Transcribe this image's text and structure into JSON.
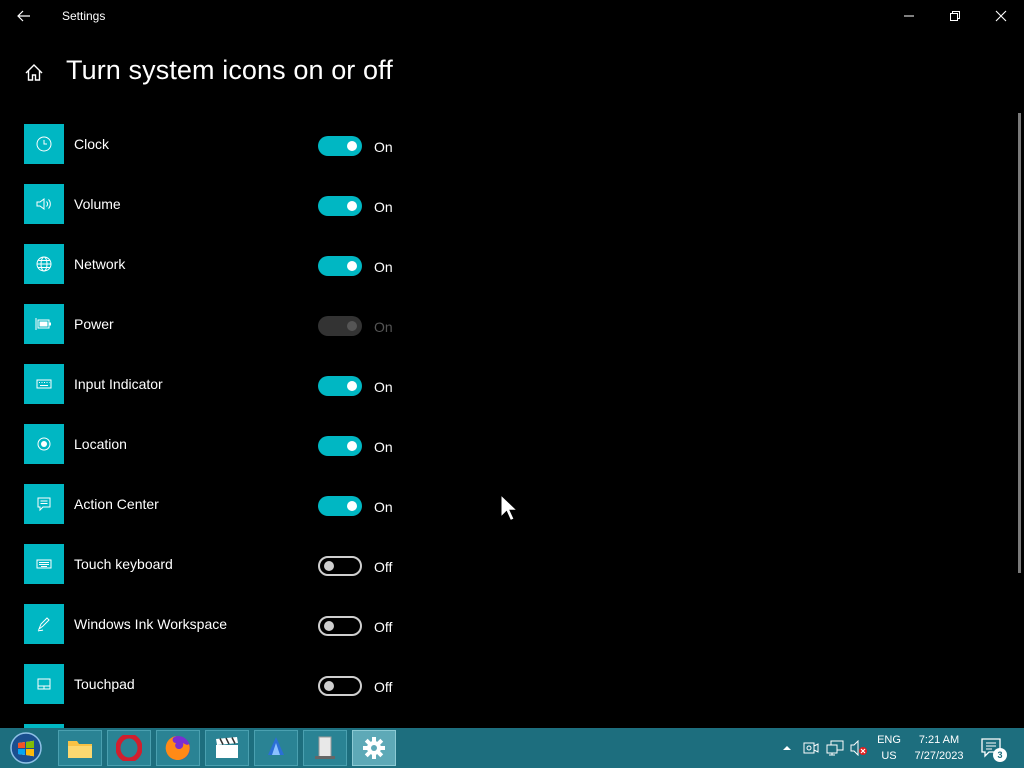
{
  "window": {
    "title": "Settings",
    "back_icon": "back-arrow-icon",
    "controls": [
      "minimize-icon",
      "maximize-icon",
      "close-icon"
    ]
  },
  "page": {
    "title": "Turn system icons on or off",
    "home_icon": "home-icon"
  },
  "colors": {
    "accent": "#00b7c3",
    "background": "#000000",
    "taskbar": "#1d6e7e"
  },
  "items": [
    {
      "label": "Clock",
      "icon": "clock-icon",
      "state": "On",
      "enabled": true,
      "interactive": true
    },
    {
      "label": "Volume",
      "icon": "volume-icon",
      "state": "On",
      "enabled": true,
      "interactive": true
    },
    {
      "label": "Network",
      "icon": "network-globe-icon",
      "state": "On",
      "enabled": true,
      "interactive": true
    },
    {
      "label": "Power",
      "icon": "battery-icon",
      "state": "On",
      "enabled": true,
      "interactive": false
    },
    {
      "label": "Input Indicator",
      "icon": "keyboard-icon",
      "state": "On",
      "enabled": true,
      "interactive": true
    },
    {
      "label": "Location",
      "icon": "location-icon",
      "state": "On",
      "enabled": true,
      "interactive": true
    },
    {
      "label": "Action Center",
      "icon": "action-center-icon",
      "state": "On",
      "enabled": true,
      "interactive": true
    },
    {
      "label": "Touch keyboard",
      "icon": "touch-keyboard-icon",
      "state": "Off",
      "enabled": false,
      "interactive": true
    },
    {
      "label": "Windows Ink Workspace",
      "icon": "pen-icon",
      "state": "Off",
      "enabled": false,
      "interactive": true
    },
    {
      "label": "Touchpad",
      "icon": "touchpad-icon",
      "state": "Off",
      "enabled": false,
      "interactive": true
    }
  ],
  "taskbar": {
    "start_icon": "windows-start-icon",
    "apps": [
      "file-explorer-icon",
      "opera-icon",
      "firefox-icon",
      "video-editor-icon",
      "app-icon",
      "file-cabinet-icon",
      "settings-gear-icon"
    ],
    "active_app": "settings-gear-icon",
    "tray_icons": [
      "show-hidden-icons-icon",
      "camera-icon",
      "network-icon",
      "volume-muted-icon"
    ],
    "language": "ENG",
    "region": "US",
    "time": "7:21 AM",
    "date": "7/27/2023",
    "notification_count": "3"
  }
}
